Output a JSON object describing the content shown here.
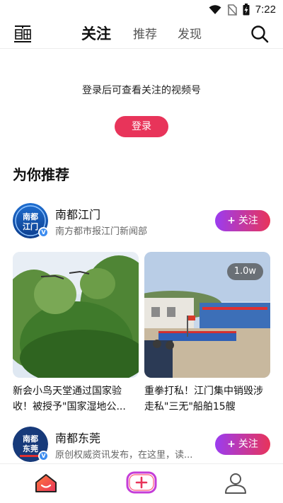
{
  "status_bar": {
    "time": "7:22"
  },
  "nav": {
    "live_label": "直播",
    "tabs": [
      {
        "label": "关注",
        "active": true
      },
      {
        "label": "推荐",
        "active": false
      },
      {
        "label": "发现",
        "active": false
      }
    ]
  },
  "login_prompt": {
    "message": "登录后可查看关注的视频号",
    "button_label": "登录"
  },
  "recommend": {
    "title": "为你推荐",
    "accounts": [
      {
        "name": "南都江门",
        "desc": "南方都市报江门新闻部",
        "avatar_text": "南都江门",
        "follow_label": "关注"
      },
      {
        "name": "南都东莞",
        "desc": "原创权威资讯发布，在这里，读...",
        "avatar_text": "南都东莞",
        "follow_label": "关注"
      }
    ],
    "cards": [
      {
        "title": "新会小鸟天堂通过国家验收！被授予\"国家湿地公...",
        "views": ""
      },
      {
        "title": "重拳打私！江门集中销毁涉走私\"三无\"船舶15艘",
        "views": "1.0w"
      }
    ]
  },
  "colors": {
    "accent": "#e8345a",
    "gradient_start": "#9b3cf0",
    "verify": "#3c8cf0"
  }
}
